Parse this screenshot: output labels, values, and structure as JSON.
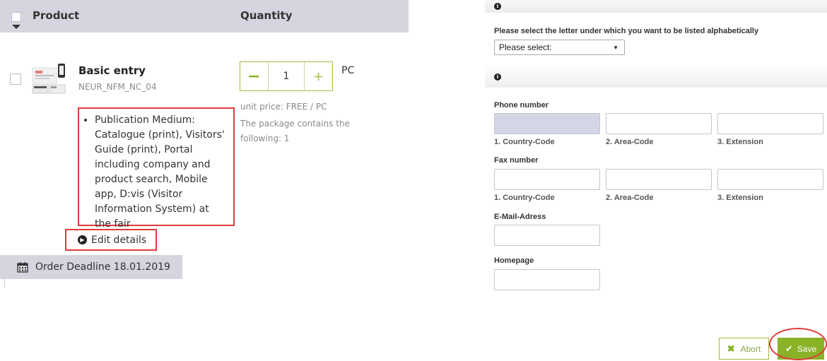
{
  "product_table": {
    "header": {
      "product_label": "Product",
      "quantity_label": "Quantity"
    },
    "row": {
      "name": "Basic entry",
      "code": "NEUR_NFM_NC_04",
      "description": "Publication Medium: Catalogue (print), Visitors' Guide (print), Portal including company and product search, Mobile app, D:vis (Visitor Information System) at the fair",
      "edit_label": "Edit details",
      "quantity": {
        "minus_label": "−",
        "value": "1",
        "plus_label": "+",
        "unit": "PC"
      },
      "unit_price": "unit price: FREE / PC",
      "package_text": "The package contains the following: 1"
    },
    "deadline": "Order Deadline 18.01.2019"
  },
  "form": {
    "letter_select": {
      "label": "Please select the letter under which you want to be listed alphabetically",
      "selected": "Please select:"
    },
    "phone": {
      "label": "Phone number",
      "country_code": "1. Country-Code",
      "area_code": "2. Area-Code",
      "extension": "3. Extension"
    },
    "fax": {
      "label": "Fax number",
      "country_code": "1. Country-Code",
      "area_code": "2. Area-Code",
      "extension": "3. Extension"
    },
    "email_label": "E-Mail-Adress",
    "homepage_label": "Homepage",
    "abort_label": "Abort",
    "save_label": "Save"
  },
  "colors": {
    "accent_green": "#8ab227",
    "highlight_red": "#e03a3a",
    "header_gray": "#d4d5de"
  },
  "icons": [
    "info-icon",
    "calendar-icon",
    "chevron-circle-right-icon",
    "times-icon",
    "check-icon"
  ]
}
